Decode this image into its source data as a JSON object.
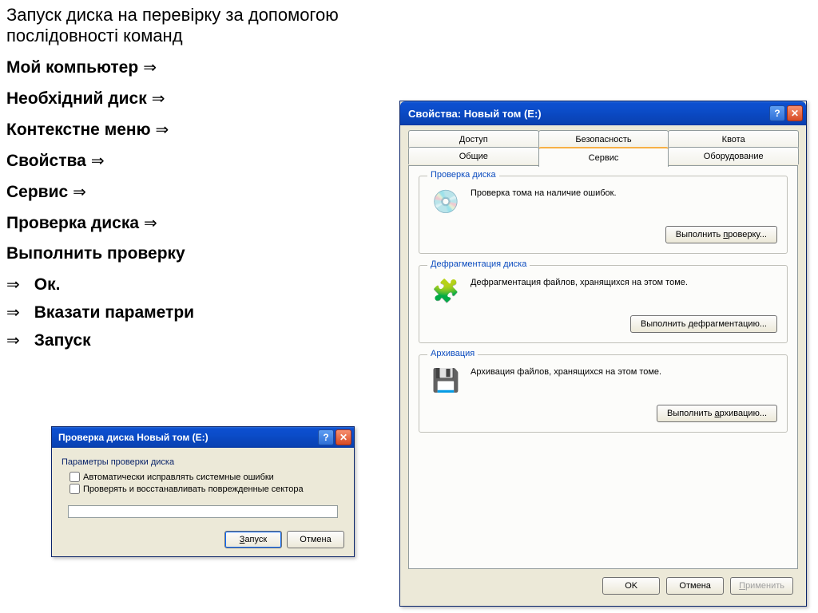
{
  "instructions": {
    "title": "Запуск диска на перевірку за допомогою послідовності команд",
    "steps": [
      "Мой компьютер",
      "Необхідний диск",
      "Контекстне меню",
      "Свойства",
      "Сервис",
      "Проверка диска",
      "Выполнить проверку"
    ],
    "substeps": [
      "Ок.",
      "Вказати параметри",
      "Запуск"
    ],
    "arrow": "⇒"
  },
  "checkDialog": {
    "title": "Проверка диска Новый том (E:)",
    "groupLabel": "Параметры проверки диска",
    "opt1": "Автоматически исправлять системные ошибки",
    "opt2": "Проверять и восстанавливать поврежденные сектора",
    "startUL": "З",
    "startRest": "апуск",
    "cancel": "Отмена"
  },
  "propsDialog": {
    "title": "Свойства: Новый том (E:)",
    "tabsRow1": [
      "Доступ",
      "Безопасность",
      "Квота"
    ],
    "tabsRow2": [
      "Общие",
      "Сервис",
      "Оборудование"
    ],
    "activeTab": "Сервис",
    "sections": {
      "check": {
        "legend": "Проверка диска",
        "text": "Проверка тома на наличие ошибок.",
        "btnPre": "Выполнить ",
        "btnUL": "п",
        "btnPost": "роверку...",
        "icon": "💿"
      },
      "defrag": {
        "legend": "Дефрагментация диска",
        "text": "Дефрагментация файлов, хранящихся на этом томе.",
        "btnPre": "Выполнить ",
        "btnUL": "д",
        "btnPost": "ефрагментацию...",
        "icon": "🧩"
      },
      "backup": {
        "legend": "Архивация",
        "text": "Архивация файлов, хранящихся на этом томе.",
        "btnPre": "Выполнить ",
        "btnUL": "а",
        "btnPost": "рхивацию...",
        "icon": "💾"
      }
    },
    "buttons": {
      "ok": "OK",
      "cancel": "Отмена",
      "applyUL": "П",
      "applyRest": "рименить"
    }
  }
}
